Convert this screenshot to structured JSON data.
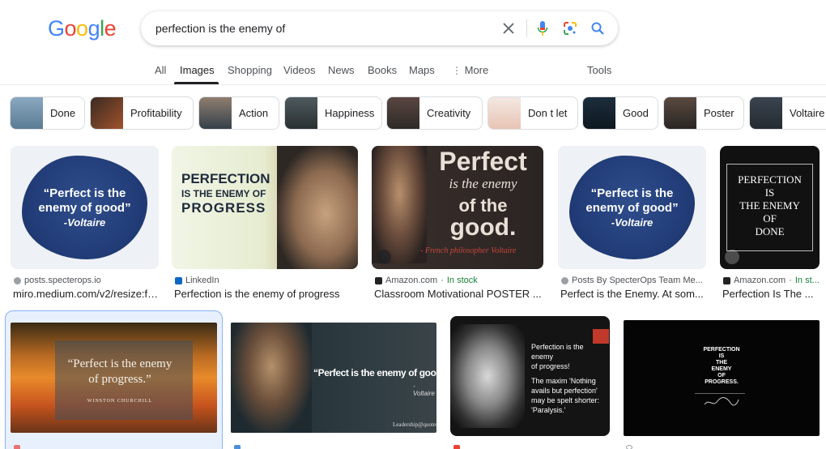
{
  "logo": "Google",
  "search": {
    "query": "perfection is the enemy of"
  },
  "tabs": [
    {
      "label": "All"
    },
    {
      "label": "Images"
    },
    {
      "label": "Shopping"
    },
    {
      "label": "Videos"
    },
    {
      "label": "News"
    },
    {
      "label": "Books"
    },
    {
      "label": "Maps"
    },
    {
      "label": "More"
    }
  ],
  "tools_label": "Tools",
  "chips": [
    {
      "label": "Done"
    },
    {
      "label": "Profitability"
    },
    {
      "label": "Action"
    },
    {
      "label": "Happiness"
    },
    {
      "label": "Creativity"
    },
    {
      "label": "Don t let"
    },
    {
      "label": "Good"
    },
    {
      "label": "Poster"
    },
    {
      "label": "Voltaire"
    }
  ],
  "results_row1": [
    {
      "source": "posts.specterops.io",
      "title": "miro.medium.com/v2/resize:fit,...",
      "quote1": "“Perfect is the",
      "quote2": "enemy of good”",
      "author": "-Voltaire"
    },
    {
      "source": "LinkedIn",
      "title": "Perfection is the enemy of progress",
      "line1": "PERFECTION",
      "line2": "IS THE ENEMY OF",
      "line3": "PROGRESS"
    },
    {
      "source": "Amazon.com",
      "stock": "In stock",
      "title": "Classroom Motivational POSTER ...",
      "big1": "Perfect",
      "big2": "is the enemy",
      "big3": "of the",
      "big4": "good.",
      "sub": "- French philosopher Voltaire"
    },
    {
      "source": "Posts By SpecterOps Team Me...",
      "title": "Perfect is the Enemy. At som...",
      "quote1": "“Perfect is the",
      "quote2": "enemy of good”",
      "author": "-Voltaire"
    },
    {
      "source": "Amazon.com",
      "stock": "In st...",
      "title": "Perfection Is The ...",
      "l1": "PERFECTION",
      "l2": "IS",
      "l3": "THE ENEMY",
      "l4": "OF",
      "l5": "DONE"
    }
  ],
  "results_row2": [
    {
      "quote1": "“Perfect is the enemy",
      "quote2": "of progress.”",
      "author": "WINSTON CHURCHILL"
    },
    {
      "quote": "“Perfect is the enemy of good”",
      "author": "- Voltaire",
      "brand": "Leadership@quotes"
    },
    {
      "t1": "Perfection is the enemy",
      "t2": "of progress!",
      "t3": "The maxim 'Nothing",
      "t4": "avails but perfection'",
      "t5": "may be spelt shorter:",
      "t6": "'Paralysis.'"
    },
    {
      "l1": "PERFECTION",
      "l2": "IS",
      "l3": "THE",
      "l4": "ENEMY",
      "l5": "OF",
      "l6": "PROGRESS."
    }
  ],
  "colors": {
    "blue": "#4285f4",
    "red": "#ea4335",
    "yellow": "#fbbc05",
    "green": "#34a853",
    "selected": "#e8f0fe"
  }
}
